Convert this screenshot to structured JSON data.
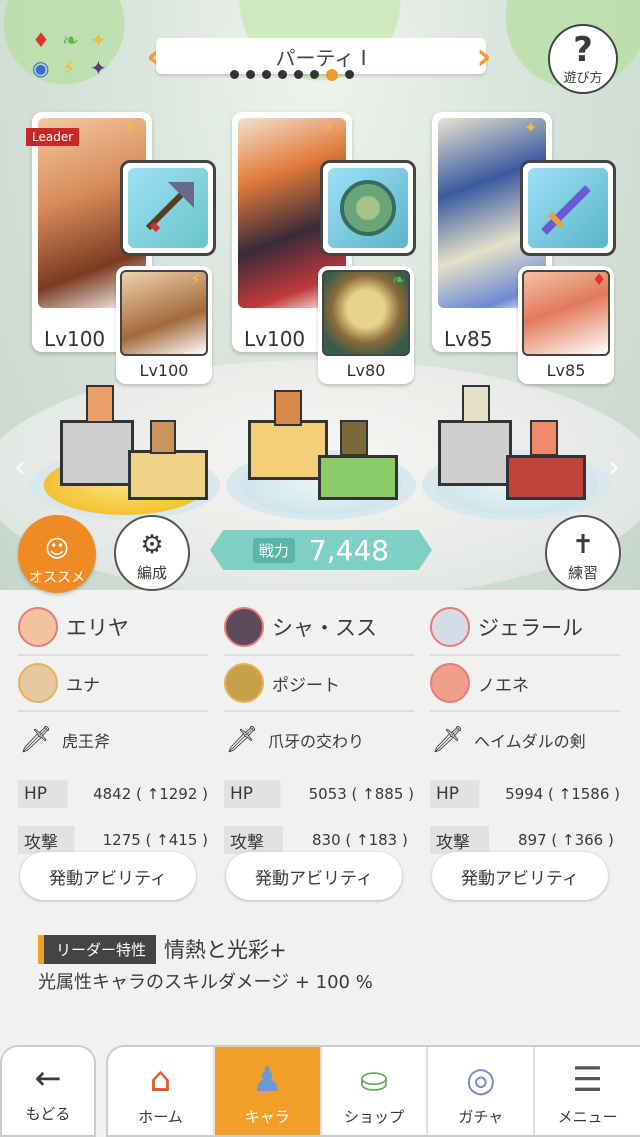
{
  "header": {
    "title": "パーティ I",
    "help_label": "遊び方",
    "page_dots": 8,
    "active_dot": 7
  },
  "leader_tag": "Leader",
  "party": [
    {
      "main_lv": "Lv100",
      "sub_lv": "Lv100",
      "main_badge": "✦",
      "sub_badge": "⚡"
    },
    {
      "main_lv": "Lv100",
      "sub_lv": "Lv80",
      "main_badge": "⚡",
      "sub_badge": "❧"
    },
    {
      "main_lv": "Lv85",
      "sub_lv": "Lv85",
      "main_badge": "✦",
      "sub_badge": "♦"
    }
  ],
  "buttons": {
    "recommend": "オススメ",
    "formation": "編成",
    "practice": "練習"
  },
  "power": {
    "label": "戦力",
    "value": "7,448"
  },
  "members": [
    {
      "main_name": "エリヤ",
      "sub_name": "ユナ",
      "weapon": "虎王斧",
      "hp_label": "HP",
      "hp": "4842 ( ↑1292 )",
      "atk_label": "攻撃",
      "atk": "1275 ( ↑415 )",
      "ability": "発動アビリティ"
    },
    {
      "main_name": "シャ・スス",
      "sub_name": "ポジート",
      "weapon": "爪牙の交わり",
      "hp_label": "HP",
      "hp": "5053 ( ↑885 )",
      "atk_label": "攻撃",
      "atk": "830 ( ↑183 )",
      "ability": "発動アビリティ"
    },
    {
      "main_name": "ジェラール",
      "sub_name": "ノエネ",
      "weapon": "ヘイムダルの剣",
      "hp_label": "HP",
      "hp": "5994 ( ↑1586 )",
      "atk_label": "攻撃",
      "atk": "897 ( ↑366 )",
      "ability": "発動アビリティ"
    }
  ],
  "leader_skill": {
    "label": "リーダー特性",
    "name": "情熱と光彩+",
    "desc": "光属性キャラのスキルダメージ + 100 %"
  },
  "nav": {
    "back": "もどる",
    "tabs": [
      "ホーム",
      "キャラ",
      "ショップ",
      "ガチャ",
      "メニュー"
    ],
    "active": "キャラ"
  },
  "colors": {
    "accent": "#f29f2a",
    "teal": "#7fd0c4",
    "leader_red": "#c62828"
  }
}
